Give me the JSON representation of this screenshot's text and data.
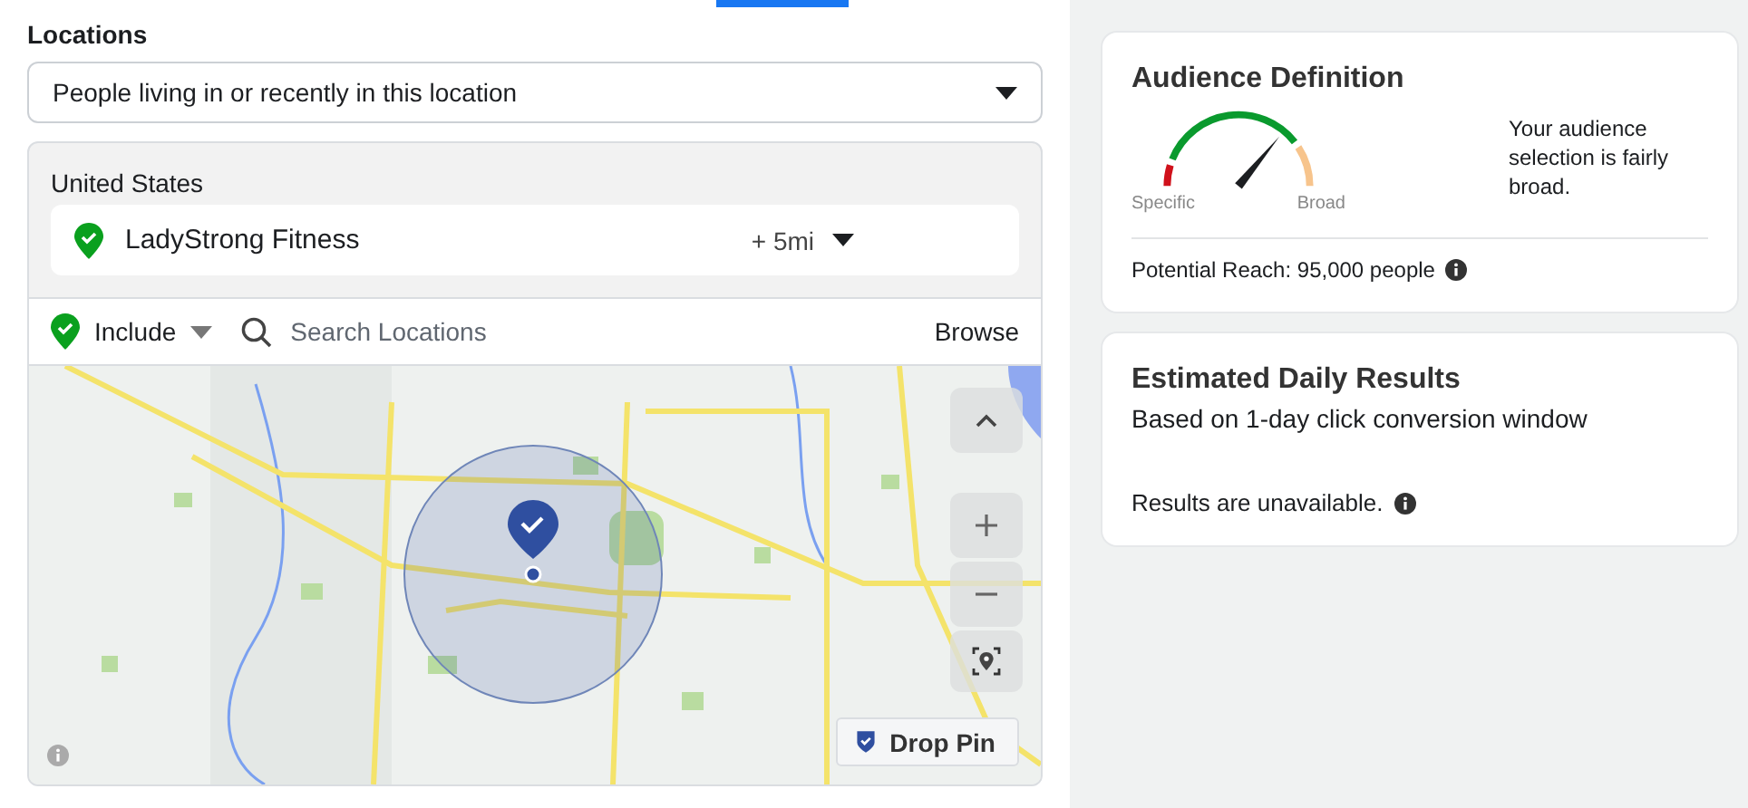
{
  "section_label": "Locations",
  "audience_type": {
    "value": "People living in or recently in this location"
  },
  "location_group": {
    "country": "United States",
    "places": [
      {
        "name": "LadyStrong Fitness",
        "radius": "+ 5mi",
        "included": true
      }
    ]
  },
  "search_bar": {
    "mode": "Include",
    "placeholder": "Search Locations",
    "browse": "Browse"
  },
  "map": {
    "drop_pin": "Drop Pin"
  },
  "audience_definition": {
    "title": "Audience Definition",
    "gauge": {
      "min_label": "Specific",
      "max_label": "Broad"
    },
    "description": "Your audience selection is fairly broad.",
    "potential_reach": "Potential Reach: 95,000 people"
  },
  "estimated_daily_results": {
    "title": "Estimated Daily Results",
    "subtitle": "Based on 1-day click conversion window",
    "message": "Results are unavailable."
  }
}
